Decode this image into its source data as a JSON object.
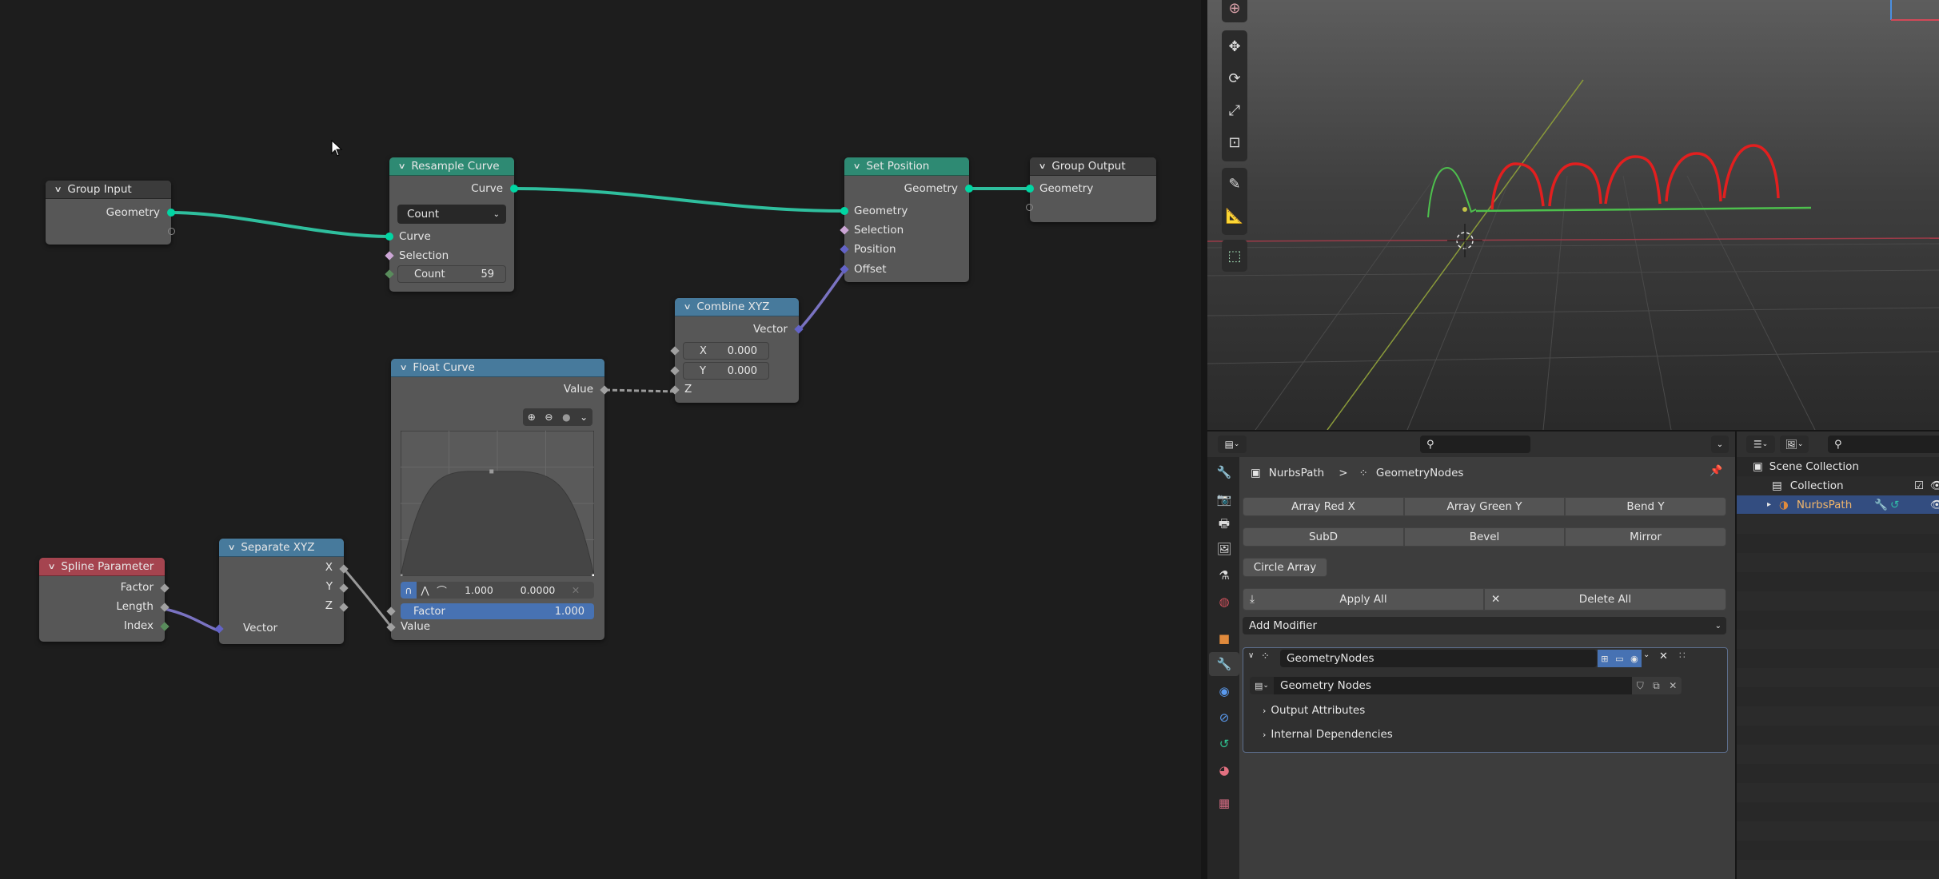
{
  "node_editor": {
    "nodes": {
      "group_input": {
        "title": "Group Input",
        "outputs": [
          "Geometry"
        ]
      },
      "resample_curve": {
        "title": "Resample Curve",
        "output": "Curve",
        "mode": "Count",
        "inputs": [
          "Curve",
          "Selection"
        ],
        "count_label": "Count",
        "count_value": "59"
      },
      "set_position": {
        "title": "Set Position",
        "output": "Geometry",
        "inputs": [
          "Geometry",
          "Selection",
          "Position",
          "Offset"
        ]
      },
      "group_output": {
        "title": "Group Output",
        "inputs": [
          "Geometry"
        ]
      },
      "combine_xyz": {
        "title": "Combine XYZ",
        "output": "Vector",
        "x_label": "X",
        "x_value": "0.000",
        "y_label": "Y",
        "y_value": "0.000",
        "z_label": "Z"
      },
      "float_curve": {
        "title": "Float Curve",
        "output": "Value",
        "point_x": "1.000",
        "point_y": "0.0000",
        "factor_label": "Factor",
        "factor_value": "1.000",
        "input": "Value",
        "curve_points": [
          [
            0.0,
            0.0
          ],
          [
            0.47,
            0.72
          ],
          [
            1.0,
            0.0
          ]
        ]
      },
      "spline_parameter": {
        "title": "Spline Parameter",
        "outputs": [
          "Factor",
          "Length",
          "Index"
        ]
      },
      "separate_xyz": {
        "title": "Separate XYZ",
        "outputs": [
          "X",
          "Y",
          "Z"
        ],
        "input": "Vector"
      }
    },
    "colors": {
      "geometry_socket": "#00d6a3",
      "vector_socket": "#6363c7",
      "float_socket": "#a1a1a1",
      "int_socket": "#598c5c",
      "bool_socket": "#cca6d6",
      "link_geometry": "#2fbf9e",
      "link_vector": "#7a73c2",
      "link_float": "#9a9a9a"
    }
  },
  "properties": {
    "search_placeholder": "",
    "breadcrumb": {
      "object": "NurbsPath",
      "separator": ">",
      "modifier": "GeometryNodes"
    },
    "quick_buttons_row1": [
      "Array Red X",
      "Array Green Y",
      "Bend Y"
    ],
    "quick_buttons_row2": [
      "SubD",
      "Bevel",
      "Mirror"
    ],
    "quick_buttons_row3": [
      "Circle Array"
    ],
    "apply_all": "Apply All",
    "delete_all": "Delete All",
    "add_modifier": "Add Modifier",
    "modifier": {
      "name": "GeometryNodes",
      "node_group": "Geometry Nodes",
      "panels": [
        "Output Attributes",
        "Internal Dependencies"
      ]
    },
    "tabs": [
      "tool",
      "render",
      "output",
      "view-layer",
      "scene",
      "world",
      "object",
      "modifiers",
      "particles",
      "physics",
      "object-data",
      "material",
      "texture"
    ],
    "active_tab": "modifiers"
  },
  "outliner": {
    "search_placeholder": "",
    "items": [
      {
        "label": "Scene Collection",
        "level": 0
      },
      {
        "label": "Collection",
        "level": 1
      },
      {
        "label": "NurbsPath",
        "level": 2,
        "selected": true
      }
    ]
  },
  "viewport": {
    "tools": [
      "cursor",
      "move",
      "rotate",
      "scale",
      "transform",
      "annotate",
      "measure",
      "add-cube"
    ]
  }
}
